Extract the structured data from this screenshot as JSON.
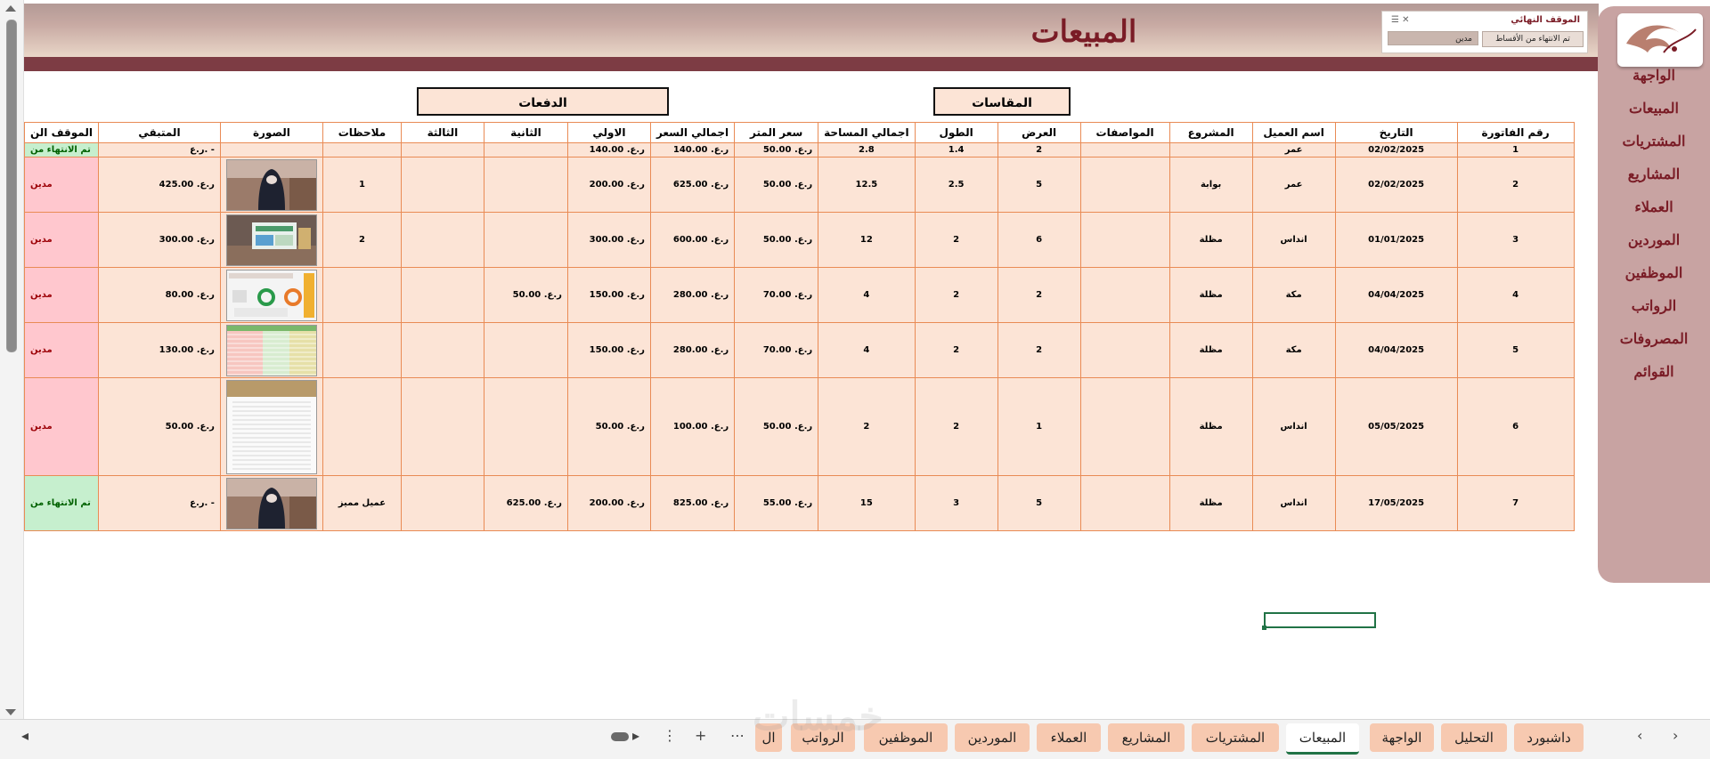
{
  "page": {
    "title": "المبيعات"
  },
  "slicer": {
    "header": "الموقف النهائي",
    "option_done": "تم الانتهاء من الأقساط",
    "option_debt": "مدين"
  },
  "nav": {
    "items": [
      "الواجهة",
      "المبيعات",
      "المشتريات",
      "المشاريع",
      "العملاء",
      "الموردين",
      "الموظفين",
      "الرواتب",
      "المصروفات",
      "القوائم"
    ]
  },
  "groups": {
    "measurements": "المقاسات",
    "payments": "الدفعات"
  },
  "columns": [
    "رقم الفاتورة",
    "التاريخ",
    "اسم العميل",
    "المشروع",
    "المواصفات",
    "العرض",
    "الطول",
    "اجمالي المساحة",
    "سعر المتر",
    "اجمالي السعر",
    "الاولي",
    "الثانية",
    "الثالثة",
    "ملاحظات",
    "الصورة",
    "المتبقي",
    "الموقف الن"
  ],
  "rows": [
    {
      "id": "1",
      "date": "02/02/2025",
      "client": "عمر",
      "project": "",
      "specs": "",
      "width": "2",
      "length": "1.4",
      "area": "2.8",
      "price_m": "ر.ع. 50.00",
      "total": "ر.ع. 140.00",
      "p1": "ر.ع. 140.00",
      "p2": "",
      "p3": "",
      "notes": "",
      "image": "",
      "remaining": "ر.ع.  -",
      "status": "تم الانتهاء من",
      "status_type": "done"
    },
    {
      "id": "2",
      "date": "02/02/2025",
      "client": "عمر",
      "project": "بوابة",
      "specs": "",
      "width": "5",
      "length": "2.5",
      "area": "12.5",
      "price_m": "ر.ع. 50.00",
      "total": "ر.ع. 625.00",
      "p1": "ر.ع. 200.00",
      "p2": "",
      "p3": "",
      "notes": "1",
      "image": "photo-woman",
      "remaining": "ر.ع. 425.00",
      "status": "مدين",
      "status_type": "debt"
    },
    {
      "id": "3",
      "date": "01/01/2025",
      "client": "انداس",
      "project": "مظلة",
      "specs": "",
      "width": "6",
      "length": "2",
      "area": "12",
      "price_m": "ر.ع. 50.00",
      "total": "ر.ع. 600.00",
      "p1": "ر.ع. 300.00",
      "p2": "",
      "p3": "",
      "notes": "2",
      "image": "screenshot-landscape",
      "remaining": "ر.ع. 300.00",
      "status": "مدين",
      "status_type": "debt"
    },
    {
      "id": "4",
      "date": "04/04/2025",
      "client": "مكة",
      "project": "مظلة",
      "specs": "",
      "width": "2",
      "length": "2",
      "area": "4",
      "price_m": "ر.ع. 70.00",
      "total": "ر.ع. 280.00",
      "p1": "ر.ع. 150.00",
      "p2": "ر.ع. 50.00",
      "p3": "",
      "notes": "",
      "image": "dashboard",
      "remaining": "ر.ع. 80.00",
      "status": "مدين",
      "status_type": "debt"
    },
    {
      "id": "5",
      "date": "04/04/2025",
      "client": "مكة",
      "project": "مظلة",
      "specs": "",
      "width": "2",
      "length": "2",
      "area": "4",
      "price_m": "ر.ع. 70.00",
      "total": "ر.ع. 280.00",
      "p1": "ر.ع. 150.00",
      "p2": "",
      "p3": "",
      "notes": "",
      "image": "spreadsheet",
      "remaining": "ر.ع. 130.00",
      "status": "مدين",
      "status_type": "debt"
    },
    {
      "id": "6",
      "date": "05/05/2025",
      "client": "انداس",
      "project": "مظلة",
      "specs": "",
      "width": "1",
      "length": "2",
      "area": "2",
      "price_m": "ر.ع. 50.00",
      "total": "ر.ع. 100.00",
      "p1": "ر.ع. 50.00",
      "p2": "",
      "p3": "",
      "notes": "",
      "image": "document",
      "remaining": "ر.ع. 50.00",
      "status": "مدين",
      "status_type": "debt"
    },
    {
      "id": "7",
      "date": "17/05/2025",
      "client": "انداس",
      "project": "مظلة",
      "specs": "",
      "width": "5",
      "length": "3",
      "area": "15",
      "price_m": "ر.ع. 55.00",
      "total": "ر.ع. 825.00",
      "p1": "ر.ع. 200.00",
      "p2": "ر.ع. 625.00",
      "p3": "",
      "notes": "عميل مميز",
      "image": "photo-woman",
      "remaining": "ر.ع.  -",
      "status": "تم الانتهاء من",
      "status_type": "done"
    }
  ],
  "sheet_tabs": [
    "داشبورد",
    "التحليل",
    "الواجهة",
    "المبيعات",
    "المشتريات",
    "المشاريع",
    "العملاء",
    "الموردين",
    "الموظفين",
    "الرواتب",
    "ال"
  ],
  "active_tab": "المبيعات",
  "watermark": "خمسات",
  "colors": {
    "accent_dark": "#7a1c26",
    "banner_bar": "#7d3c44",
    "row_fill": "#fce4d6",
    "grid": "#e98b55",
    "nav_bg": "#c8a3a2",
    "done_bg": "#c6efce",
    "debt_bg": "#ffc7ce"
  }
}
